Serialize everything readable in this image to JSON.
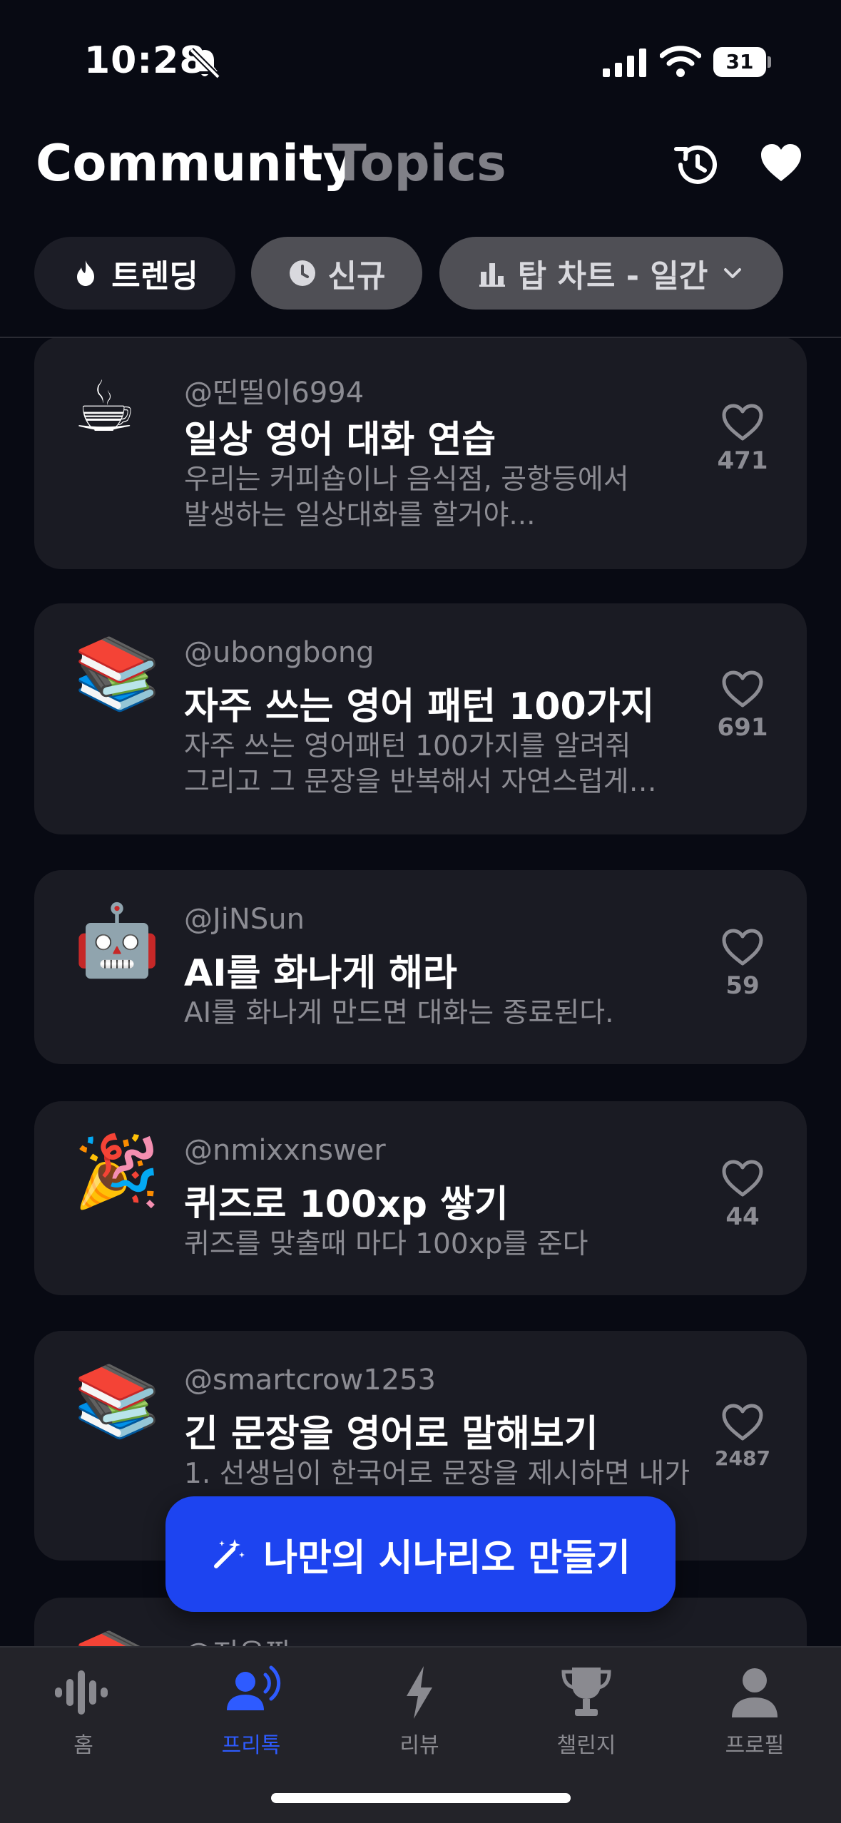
{
  "status_bar": {
    "time": "10:28",
    "battery": "31"
  },
  "header": {
    "tab_active": "Community",
    "tab_inactive": "Topics",
    "icons": [
      "history-icon",
      "heart-icon"
    ]
  },
  "filters": [
    {
      "label": "트렌딩",
      "icon": "flame-icon",
      "selected": true
    },
    {
      "label": "신규",
      "icon": "clock-icon",
      "selected": false
    },
    {
      "label": "탑 차트 - 일간",
      "icon": "bar-chart-icon",
      "selected": false
    }
  ],
  "posts": [
    {
      "emoji": "☕",
      "author": "@띤띨이6994",
      "title": "일상 영어 대화 연습",
      "desc": [
        "우리는 커피숍이나 음식점, 공항등에서",
        "발생하는 일상대화를 할거야..."
      ],
      "likes": "471"
    },
    {
      "emoji": "📚",
      "author": "@ubongbong",
      "title": "자주 쓰는 영어 패턴 100가지",
      "desc": [
        "자주 쓰는 영어패턴 100가지를 알려줘",
        "그리고 그  문장을 반복해서 자연스럽게…"
      ],
      "likes": "691"
    },
    {
      "emoji": "🤖",
      "author": "@JiNSun",
      "title": "AI를 화나게 해라",
      "desc": [
        "AI를 화나게 만드면 대화는 종료된다."
      ],
      "likes": "59"
    },
    {
      "emoji": "🎉",
      "author": "@nmixxnswer",
      "title": "퀴즈로 100xp 쌓기",
      "desc": [
        "퀴즈를 맞출때 마다 100xp를 준다"
      ],
      "likes": "44"
    },
    {
      "emoji": "📚",
      "author": "@smartcrow1253",
      "title": "긴 문장을 영어로 말해보기",
      "desc": [
        "1. 선생님이 한국어로 문장을 제시하면 내가"
      ],
      "likes": "2487"
    },
    {
      "emoji": "📚",
      "author": "@지우짱",
      "title": "",
      "desc": [],
      "likes": ""
    }
  ],
  "cta": {
    "label": "나만의 시나리오 만들기",
    "icon": "magic-wand-icon"
  },
  "tab_bar": [
    {
      "label": "홈",
      "icon": "waveform-icon",
      "active": false
    },
    {
      "label": "프리톡",
      "icon": "people-talk-icon",
      "active": true
    },
    {
      "label": "리뷰",
      "icon": "bolt-icon",
      "active": false
    },
    {
      "label": "챌린지",
      "icon": "trophy-icon",
      "active": false
    },
    {
      "label": "프로필",
      "icon": "person-icon",
      "active": false
    }
  ],
  "colors": {
    "background": "#080a13",
    "card": "#1a1b23",
    "accent": "#1d44f0",
    "active_tab": "#2e5bff",
    "muted_text": "#8c8c93"
  }
}
